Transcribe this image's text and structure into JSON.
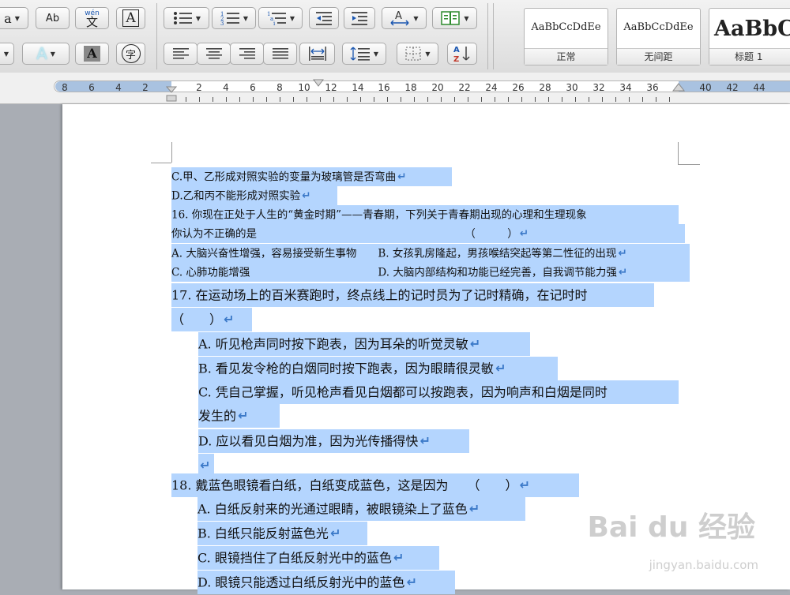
{
  "toolbar": {
    "phonetic_label": "wén",
    "phonetic_char": "文",
    "spell_label": "Ab",
    "char_border_label": "A",
    "text_effect_label": "A",
    "char_shading_label": "A",
    "enclose_label": "字",
    "font_color_label": "a",
    "font_color_letter": "A"
  },
  "styles": {
    "items": [
      {
        "sample": "AaBbCcDdEe",
        "caption": "正常"
      },
      {
        "sample": "AaBbCcDdEe",
        "caption": "无间距"
      },
      {
        "sample": "AaBbC",
        "caption": "标题 1"
      }
    ]
  },
  "ruler": {
    "labels": [
      "8",
      "6",
      "4",
      "2",
      "2",
      "4",
      "6",
      "8",
      "10",
      "12",
      "14",
      "16",
      "18",
      "20",
      "22",
      "24",
      "26",
      "28",
      "30",
      "32",
      "34",
      "36",
      "40",
      "42",
      "44"
    ]
  },
  "document": {
    "lines": [
      {
        "text": "C.甲、乙形成对照实验的变量为玻璃管是否弯曲",
        "mark": "↵"
      },
      {
        "text": "D.乙和丙不能形成对照实验",
        "mark": "↵"
      },
      {
        "text": "16. 你现在正处于人生的“黄金时期”——青春期，下列关于青春期出现的心理和生理现象",
        "mark": ""
      },
      {
        "text": "你认为不正确的是　　　　　　　　　　　　　　　　　　　　（　　　）",
        "mark": "↵"
      },
      {
        "text": "A. 大脑兴奋性增强，容易接受新生事物　　B. 女孩乳房隆起，男孩喉结突起等第二性征的出现",
        "mark": "↵"
      },
      {
        "text": "C. 心肺功能增强　　　　　　　　　　　　D. 大脑内部结构和功能已经完善，自我调节能力强",
        "mark": "↵"
      },
      {
        "text": "17. 在运动场上的百米赛跑时，终点线上的记时员为了记时精确，在记时时",
        "mark": ""
      },
      {
        "text": "（　　）",
        "mark": "↵"
      },
      {
        "text": "A. 听见枪声同时按下跑表，因为耳朵的听觉灵敏",
        "mark": "↵"
      },
      {
        "text": "B. 看见发令枪的白烟同时按下跑表，因为眼睛很灵敏",
        "mark": "↵"
      },
      {
        "text": "C. 凭自己掌握，听见枪声看见白烟都可以按跑表，因为响声和白烟是同时",
        "mark": ""
      },
      {
        "text": "发生的",
        "mark": "↵"
      },
      {
        "text": "D. 应以看见白烟为准，因为光传播得快",
        "mark": "↵"
      },
      {
        "text": "",
        "mark": "↵"
      },
      {
        "text": "18. 戴蓝色眼镜看白纸，白纸变成蓝色，这是因为　　（　　）",
        "mark": "↵"
      },
      {
        "text": "A. 白纸反射来的光通过眼睛，被眼镜染上了蓝色",
        "mark": "↵"
      },
      {
        "text": "B. 白纸只能反射蓝色光",
        "mark": "↵"
      },
      {
        "text": "C. 眼镜挡住了白纸反射光中的蓝色",
        "mark": "↵"
      },
      {
        "text": "D. 眼镜只能透过白纸反射光中的蓝色",
        "mark": "↵"
      }
    ]
  },
  "watermark": {
    "brand": "Bai du 经验",
    "url": "jingyan.baidu.com"
  },
  "colors": {
    "selection": "#b4d5fe",
    "paragraph_mark": "#3b79c8"
  }
}
